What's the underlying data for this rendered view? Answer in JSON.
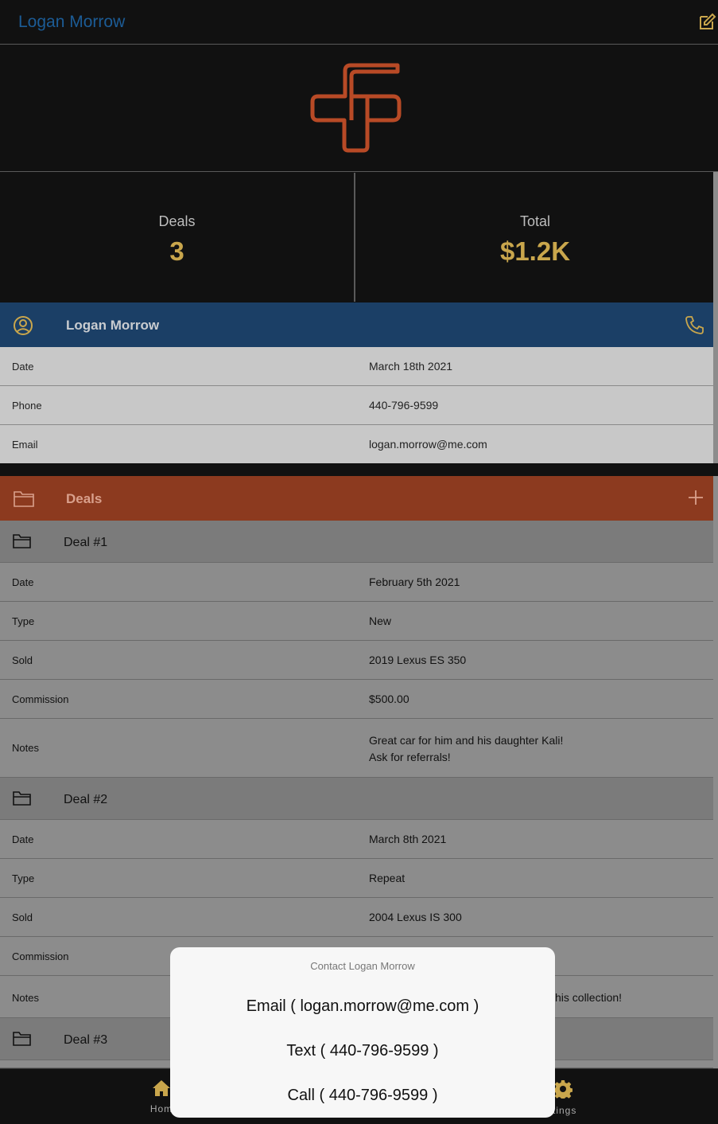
{
  "header": {
    "title": "Logan Morrow",
    "edit_icon": "edit-icon"
  },
  "colors": {
    "accent_gold": "#c9a64c",
    "contact_blue": "#1b3f66",
    "deals_red": "#8c3a1f",
    "logo_orange": "#b84a26"
  },
  "stats": {
    "deals_label": "Deals",
    "deals_value": "3",
    "total_label": "Total",
    "total_value": "$1.2K"
  },
  "contact": {
    "name": "Logan Morrow",
    "rows": [
      {
        "key": "Date",
        "value": "March 18th 2021"
      },
      {
        "key": "Phone",
        "value": "440-796-9599"
      },
      {
        "key": "Email",
        "value": "logan.morrow@me.com"
      }
    ]
  },
  "deals_section": {
    "title": "Deals"
  },
  "deals": [
    {
      "title": "Deal #1",
      "rows": [
        {
          "key": "Date",
          "value": "February 5th 2021"
        },
        {
          "key": "Type",
          "value": "New"
        },
        {
          "key": "Sold",
          "value": "2019 Lexus ES 350"
        },
        {
          "key": "Commission",
          "value": "$500.00"
        }
      ],
      "notes_key": "Notes",
      "notes_line1": "Great car for him and his daughter Kali!",
      "notes_line2": "Ask for referrals!"
    },
    {
      "title": "Deal #2",
      "rows": [
        {
          "key": "Date",
          "value": "March 8th 2021"
        },
        {
          "key": "Type",
          "value": "Repeat"
        },
        {
          "key": "Sold",
          "value": "2004 Lexus IS 300"
        },
        {
          "key": "Commission",
          "value": ""
        }
      ],
      "notes_key": "Notes",
      "notes_partial": "his collection!"
    },
    {
      "title": "Deal #3"
    }
  ],
  "tabs": {
    "home": "Hom",
    "settings": "ttings"
  },
  "action_sheet": {
    "title": "Contact Logan Morrow",
    "email": "Email ( logan.morrow@me.com )",
    "text": "Text ( 440-796-9599 )",
    "call": "Call ( 440-796-9599 )"
  }
}
